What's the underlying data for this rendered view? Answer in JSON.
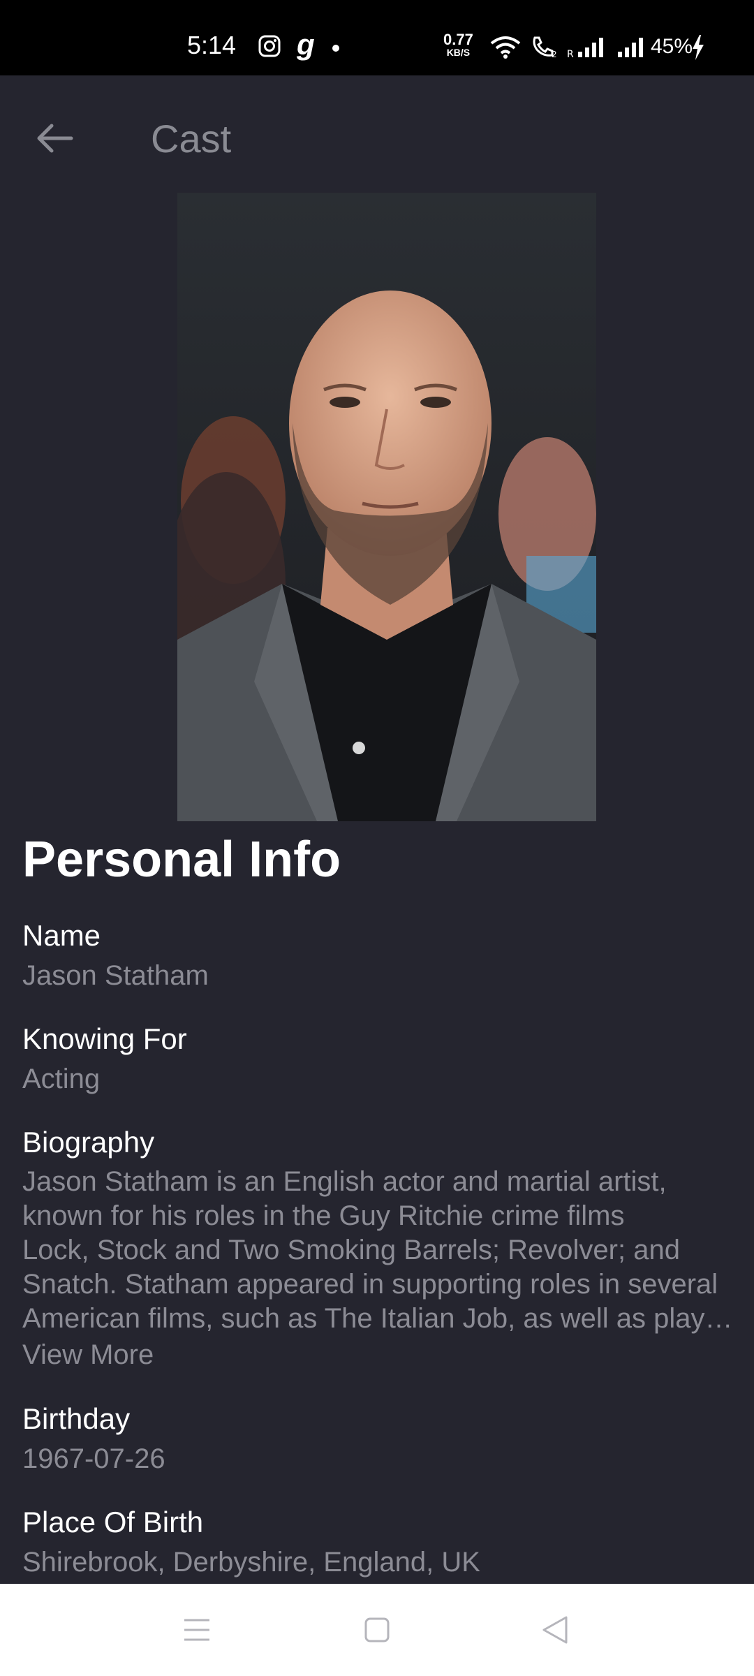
{
  "status_bar": {
    "time": "5:14",
    "net_speed_value": "0.77",
    "net_speed_unit": "KB/S",
    "battery": "45%"
  },
  "app_bar": {
    "title": "Cast"
  },
  "personal_info": {
    "section_title": "Personal Info",
    "name_label": "Name",
    "name_value": "Jason Statham",
    "known_for_label": "Knowing For",
    "known_for_value": "Acting",
    "biography_label": "Biography",
    "biography_lines": [
      "Jason Statham is an English actor and martial artist,",
      "known for his roles in the Guy Ritchie crime films",
      "Lock, Stock and Two Smoking Barrels; Revolver; and",
      "Snatch. Statham appeared in supporting roles in several",
      "American films, such as The Italian Job, as well as play…"
    ],
    "view_more": "View More",
    "birthday_label": "Birthday",
    "birthday_value": "1967-07-26",
    "place_of_birth_label": "Place Of Birth",
    "place_of_birth_value": "Shirebrook, Derbyshire, England, UK"
  },
  "colors": {
    "background": "#25252f",
    "label": "#ffffff",
    "value": "#8c8c95"
  }
}
